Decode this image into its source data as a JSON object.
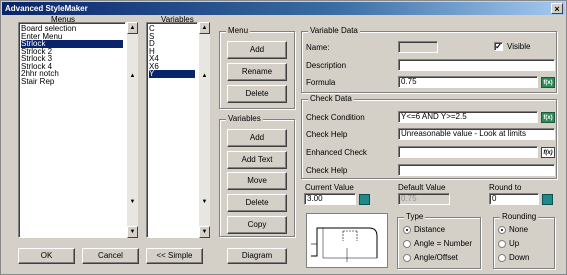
{
  "title": "Advanced StyleMaker",
  "close_glyph": "×",
  "menus": {
    "label": "Menus",
    "items": [
      "Board selection",
      "Enter Menu",
      "Strlock",
      "Strlock 2",
      "Strlock 3",
      "Strlock 4",
      "2hhr notch",
      "Stair Rep"
    ],
    "selected_index": 2
  },
  "variables": {
    "label": "Variables",
    "items": [
      "C",
      "S",
      "D",
      "H",
      "X4",
      "X6",
      "Y"
    ],
    "selected_index": 6
  },
  "menu_group": {
    "label": "Menu",
    "add": "Add",
    "rename": "Rename",
    "delete": "Delete"
  },
  "variables_group": {
    "label": "Variables",
    "add": "Add",
    "add_text": "Add Text",
    "move": "Move",
    "delete": "Delete",
    "copy": "Copy"
  },
  "bottom": {
    "ok": "OK",
    "cancel": "Cancel",
    "simple": "<< Simple",
    "diagram": "Diagram"
  },
  "variable_data": {
    "label": "Variable Data",
    "name_label": "Name:",
    "name_value": "",
    "visible_label": "Visible",
    "visible_checked": true,
    "description_label": "Description",
    "description_value": "",
    "formula_label": "Formula",
    "formula_value": "0.75",
    "fx": "f(x)"
  },
  "check_data": {
    "label": "Check Data",
    "condition_label": "Check Condition",
    "condition_value": "Y<=6 AND Y>=2.5",
    "help_label": "Check Help",
    "help_value": "Unreasonable value - Look at limits",
    "enhanced_label": "Enhanced Check",
    "enhanced_value": "",
    "help2_label": "Check Help",
    "help2_value": ""
  },
  "values": {
    "current_label": "Current Value",
    "current_value": "3.00",
    "default_label": "Default Value",
    "default_value": "0.75",
    "round_label": "Round to",
    "round_value": "0"
  },
  "type_group": {
    "label": "Type",
    "options": [
      "Distance",
      "Angle = Number",
      "Angle/Offset"
    ],
    "selected_index": 0
  },
  "rounding_group": {
    "label": "Rounding",
    "options": [
      "None",
      "Up",
      "Down"
    ],
    "selected_index": 0
  }
}
